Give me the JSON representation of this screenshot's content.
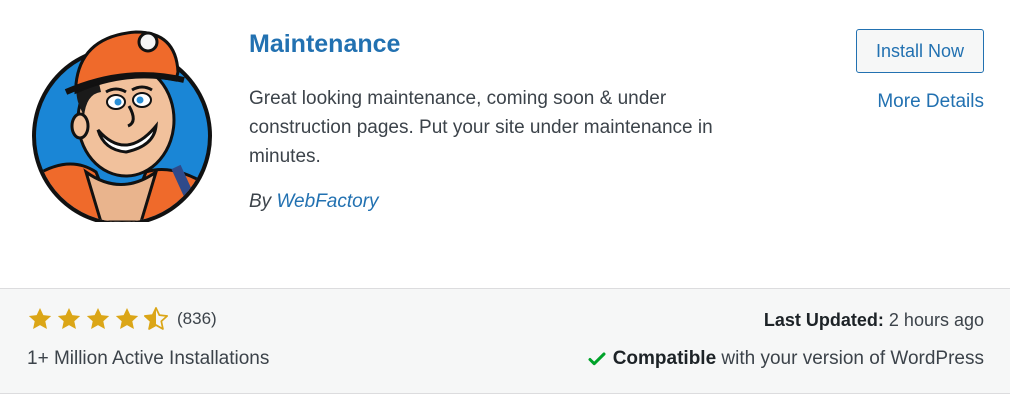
{
  "plugin": {
    "name": "Maintenance",
    "description": "Great looking maintenance, coming soon & under construction pages. Put your site under maintenance in minutes.",
    "author_prefix": "By",
    "author": "WebFactory",
    "icon": "construction-worker-mascot"
  },
  "actions": {
    "install_label": "Install Now",
    "more_details_label": "More Details"
  },
  "rating": {
    "stars": 4.5,
    "max": 5,
    "count_text": "(836)"
  },
  "stats": {
    "installs": "1+ Million Active Installations",
    "last_updated_label": "Last Updated:",
    "last_updated_value": "2 hours ago",
    "compatible_label": "Compatible",
    "compatible_rest": "with your version of WordPress"
  },
  "colors": {
    "link": "#2271b1",
    "star": "#dba617",
    "check": "#00a32a",
    "footer_bg": "#f6f7f7"
  }
}
